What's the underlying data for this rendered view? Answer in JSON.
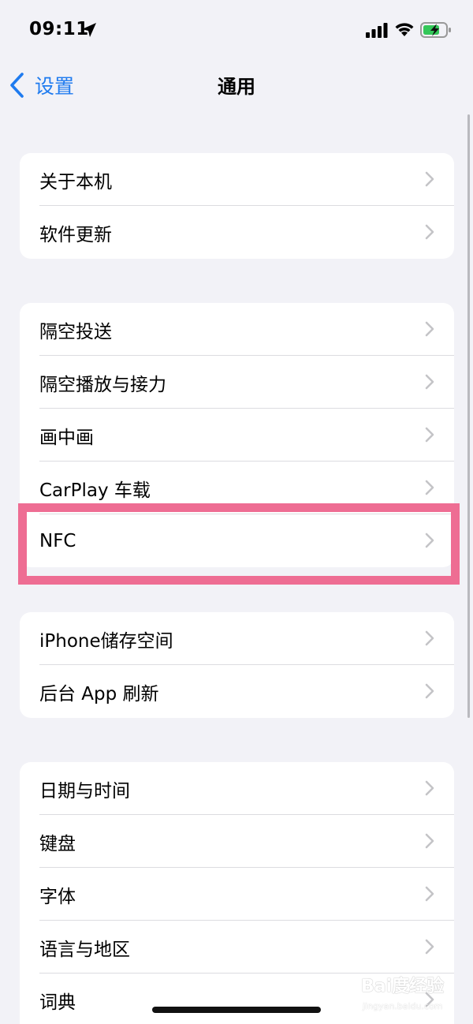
{
  "status_bar": {
    "time": "09:11",
    "location_icon": "location-arrow-icon",
    "signal_icon": "cellular-signal-icon",
    "wifi_icon": "wifi-icon",
    "battery_icon": "battery-charging-icon",
    "battery_color": "#34c759"
  },
  "nav": {
    "back_label": "设置",
    "title": "通用",
    "accent_color": "#1f7bef"
  },
  "groups": [
    {
      "items": [
        {
          "label": "关于本机"
        },
        {
          "label": "软件更新"
        }
      ]
    },
    {
      "items": [
        {
          "label": "隔空投送"
        },
        {
          "label": "隔空播放与接力"
        },
        {
          "label": "画中画"
        },
        {
          "label": "CarPlay 车载"
        },
        {
          "label": "NFC"
        }
      ]
    },
    {
      "items": [
        {
          "label": "iPhone储存空间"
        },
        {
          "label": "后台 App 刷新"
        }
      ]
    },
    {
      "items": [
        {
          "label": "日期与时间"
        },
        {
          "label": "键盘"
        },
        {
          "label": "字体"
        },
        {
          "label": "语言与地区"
        },
        {
          "label": "词典"
        }
      ]
    }
  ],
  "highlight": {
    "target": "NFC",
    "color": "#ee6d93"
  },
  "watermark": {
    "logo": "Bai度经验",
    "sub": "jingyan.baidu.com"
  }
}
